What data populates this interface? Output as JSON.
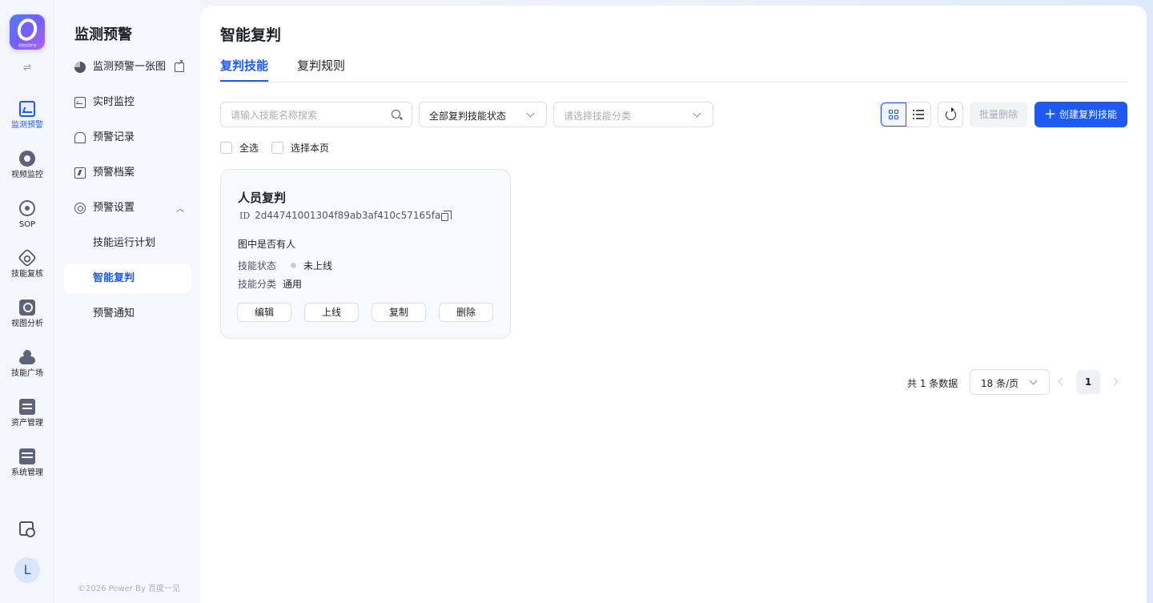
{
  "logo": {
    "caption": "视觉应用平台"
  },
  "rail": {
    "items": [
      {
        "label": "监测预警",
        "icon": "chart-icon",
        "active": true
      },
      {
        "label": "视频监控",
        "icon": "camera-icon"
      },
      {
        "label": "SOP",
        "icon": "sop-icon"
      },
      {
        "label": "技能复核",
        "icon": "skill-review-icon"
      },
      {
        "label": "视图分析",
        "icon": "view-analysis-icon"
      },
      {
        "label": "技能广场",
        "icon": "skill-plaza-icon"
      },
      {
        "label": "资产管理",
        "icon": "asset-icon"
      },
      {
        "label": "系统管理",
        "icon": "system-icon"
      }
    ],
    "toggle": "⇌",
    "avatar": "L"
  },
  "sidebar": {
    "title": "监测预警",
    "items": [
      {
        "label": "监测预警一张图",
        "icon": "pie-icon"
      },
      {
        "label": "实时监控",
        "icon": "monitor-icon"
      },
      {
        "label": "预警记录",
        "icon": "alarm-record-icon"
      },
      {
        "label": "预警档案",
        "icon": "archive-icon"
      },
      {
        "label": "预警设置",
        "icon": "settings-icon"
      },
      {
        "label": "技能运行计划"
      },
      {
        "label": "智能复判",
        "active": true
      },
      {
        "label": "预警通知"
      }
    ],
    "footer": "©2026 Power By 百度一见"
  },
  "main": {
    "title": "智能复判",
    "tabs": [
      {
        "label": "复判技能",
        "active": true
      },
      {
        "label": "复判规则"
      }
    ]
  },
  "toolbar": {
    "search_placeholder": "请输入技能名称搜索",
    "status_select": "全部复判技能状态",
    "category_placeholder": "请选择技能分类",
    "bulk_delete": "批量删除",
    "create": "创建复判技能"
  },
  "selection": {
    "select_all": "全选",
    "select_page": "选择本页"
  },
  "cards": [
    {
      "title": "人员复判",
      "id_label": "ID",
      "id": "2d44741001304f89ab3af410c57165fa",
      "description": "图中是否有人",
      "status_label": "技能状态",
      "status": "未上线",
      "status_color": "#c9cdd4",
      "category_label": "技能分类",
      "category": "通用",
      "actions": [
        "编辑",
        "上线",
        "复制",
        "删除"
      ]
    }
  ],
  "pagination": {
    "total": "共 1 条数据",
    "page_size": "18 条/页",
    "current_page": "1"
  },
  "colors": {
    "accent": "#1d5af5",
    "text": "#1d2129",
    "muted": "#a9aeb8"
  }
}
